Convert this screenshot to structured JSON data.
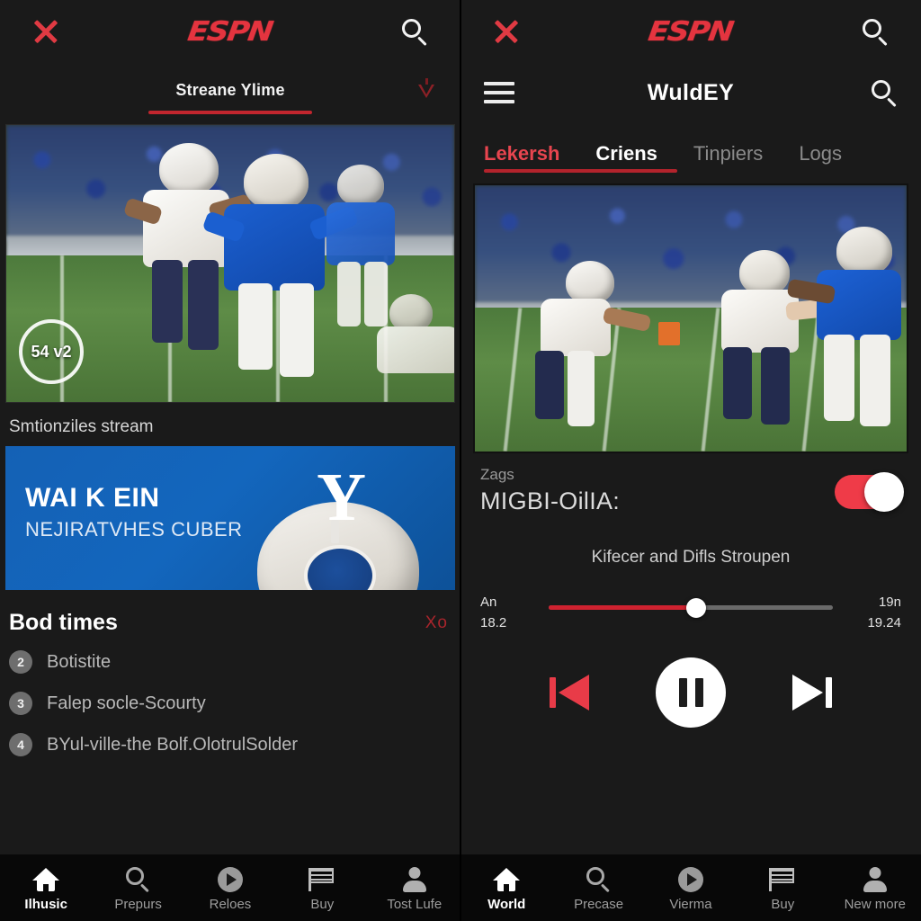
{
  "brand": {
    "logo_text": "ESPN",
    "accent_red": "#e4343f",
    "dark_bg": "#1a1a1a"
  },
  "left_panel": {
    "topbar": {
      "close_icon": "close-icon",
      "logo": "ESPN",
      "search_icon": "search-icon"
    },
    "subtitle": "Streane Ylime",
    "caret_icon": "chevron-down-icon",
    "video": {
      "live_badge": "54 v2"
    },
    "section_label": "Smtionziles stream",
    "promo": {
      "title": "WAI K EIN",
      "subtitle": "NEJIRATVHES CUBER",
      "logo_letter": "Y"
    },
    "list": {
      "title": "Bod times",
      "action": "Xo",
      "items": [
        {
          "num": "2",
          "text": "Botistite"
        },
        {
          "num": "3",
          "text": "Falep socle-Scourty"
        },
        {
          "num": "4",
          "text": "BYul-ville-the Bolf.OlotrulSolder"
        }
      ]
    },
    "bottom_nav": [
      {
        "label": "Ilhusic",
        "icon": "home-icon",
        "active": true
      },
      {
        "label": "Prepurs",
        "icon": "search-icon",
        "active": false
      },
      {
        "label": "Reloes",
        "icon": "play-circle-icon",
        "active": false
      },
      {
        "label": "Buy",
        "icon": "flag-icon",
        "active": false
      },
      {
        "label": "Tost Lufe",
        "icon": "person-icon",
        "active": false
      }
    ]
  },
  "right_panel": {
    "topbar": {
      "close_icon": "close-icon",
      "logo": "ESPN",
      "search_icon": "search-icon"
    },
    "title_row": {
      "menu_icon": "hamburger-icon",
      "title": "WuldEY",
      "search_icon": "search-icon"
    },
    "tabs": [
      {
        "label": "Lekersh",
        "state": "active"
      },
      {
        "label": "Criens",
        "state": "current"
      },
      {
        "label": "Tinpiers",
        "state": "dim"
      },
      {
        "label": "Logs",
        "state": "dim"
      }
    ],
    "meta": {
      "small": "Zags",
      "big": "MIGBI-OilIA:",
      "toggle_on": true,
      "toggle_color": "#ef3b48"
    },
    "now_playing": "Kifecer and Difls Stroupen",
    "scrubber": {
      "left_top": "An",
      "left_bottom": "18.2",
      "right_top": "19n",
      "right_bottom": "19.24",
      "progress_percent": 52,
      "fill_color": "#cf2230"
    },
    "controls": {
      "previous": "previous-track-icon",
      "play_pause": "pause-icon",
      "next": "next-track-icon"
    },
    "bottom_nav": [
      {
        "label": "World",
        "icon": "home-icon",
        "active": true
      },
      {
        "label": "Precase",
        "icon": "search-icon",
        "active": false
      },
      {
        "label": "Vierma",
        "icon": "play-circle-icon",
        "active": false
      },
      {
        "label": "Buy",
        "icon": "flag-icon",
        "active": false
      },
      {
        "label": "New more",
        "icon": "person-icon",
        "active": false
      }
    ]
  }
}
